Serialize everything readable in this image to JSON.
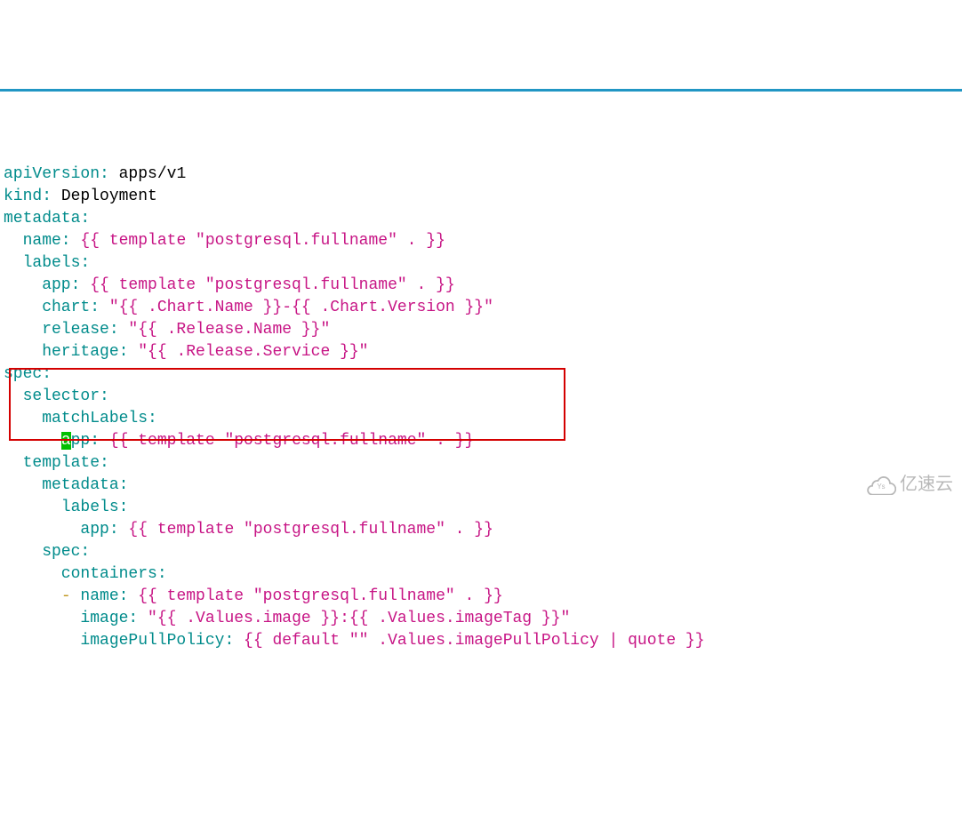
{
  "lines": {
    "l1_key": "apiVersion:",
    "l1_val": " apps/v1",
    "l2_key": "kind:",
    "l2_val": " Deployment",
    "l3_key": "metadata:",
    "l4_key": "  name:",
    "l4_tmpl": " {{ template \"postgresql.fullname\" . }}",
    "l5_key": "  labels:",
    "l6_key": "    app:",
    "l6_tmpl": " {{ template \"postgresql.fullname\" . }}",
    "l7_key": "    chart:",
    "l7_str": " \"{{ .Chart.Name }}-{{ .Chart.Version }}\"",
    "l8_key": "    release:",
    "l8_str": " \"{{ .Release.Name }}\"",
    "l9_key": "    heritage:",
    "l9_str": " \"{{ .Release.Service }}\"",
    "l10_key": "spec:",
    "l11_key": "  selector:",
    "l12_key": "    matchLabels:",
    "l13_pad": "      ",
    "l13_cursor": "a",
    "l13_key": "pp:",
    "l13_tmpl": " {{ template \"postgresql.fullname\" . }}",
    "l14_key": "  template:",
    "l15_key": "    metadata:",
    "l16_key": "      labels:",
    "l17_key": "        app:",
    "l17_tmpl": " {{ template \"postgresql.fullname\" . }}",
    "l18_key": "    spec:",
    "l19_key": "      containers:",
    "l20_pad": "      ",
    "l20_dash": "-",
    "l20_key": " name:",
    "l20_tmpl": " {{ template \"postgresql.fullname\" . }}",
    "l21_key": "        image:",
    "l21_str": " \"{{ .Values.image }}:{{ .Values.imageTag }}\"",
    "l22_key": "        imagePullPolicy:",
    "l22_tmpl": " {{ default \"\" .Values.imagePullPolicy | quote }}"
  },
  "watermark": "亿速云"
}
